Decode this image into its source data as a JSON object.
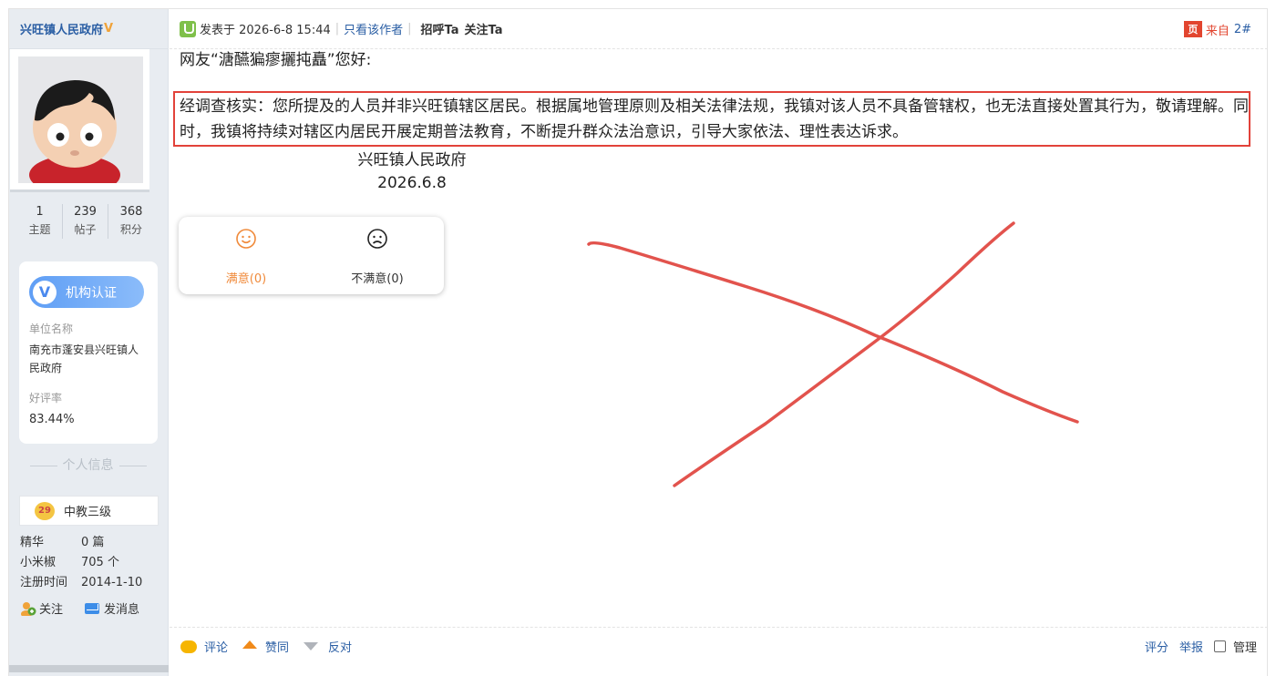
{
  "author": {
    "name": "兴旺镇人民政府",
    "verified_mark": "V",
    "avatar_icon": "cartoon-boy-avatar",
    "stats": [
      {
        "value": "1",
        "label": "主题"
      },
      {
        "value": "239",
        "label": "帖子"
      },
      {
        "value": "368",
        "label": "积分"
      }
    ],
    "cert": {
      "badge": "机构认证",
      "badge_icon": "V",
      "unit_label": "单位名称",
      "unit_value": "南充市蓬安县兴旺镇人民政府",
      "rate_label": "好评率",
      "rate_value": "83.44%"
    },
    "personal_title": "个人信息",
    "level": {
      "badge": "29",
      "text": "中教三级"
    },
    "info": [
      {
        "key": "精华",
        "value": "0 篇"
      },
      {
        "key": "小米椒",
        "value": "705 个"
      },
      {
        "key": "注册时间",
        "value": "2014-1-10"
      }
    ],
    "actions": {
      "follow": "关注",
      "message": "发消息"
    }
  },
  "post": {
    "posted_at": "发表于 2026-6-8 15:44",
    "only_author": "只看该作者",
    "greet": "招呼Ta",
    "follow_ta": "关注Ta",
    "from_icon": "页",
    "from": "来自",
    "floor": "2#",
    "greeting": "网友“溏醼猵瘳攦扽矗”您好:",
    "body": "经调查核实：您所提及的人员并非兴旺镇辖区居民。根据属地管理原则及相关法律法规，我镇对该人员不具备管辖权，也无法直接处置其行为，敬请理解。同时，我镇将持续对辖区内居民开展定期普法教育，不断提升群众法治意识，引导大家依法、理性表达诉求。",
    "signature": "兴旺镇人民政府",
    "date": "2026.6.8"
  },
  "rating": {
    "satisfied": "满意(0)",
    "dissatisfied": "不满意(0)"
  },
  "footer": {
    "comment": "评论",
    "agree": "赞同",
    "oppose": "反对",
    "score": "评分",
    "report": "举报",
    "manage": "管理"
  },
  "colors": {
    "link": "#2a5ea4",
    "highlight_border": "#e2423a",
    "cross": "#e2534d",
    "sidebar_bg": "#e8ecf1"
  }
}
